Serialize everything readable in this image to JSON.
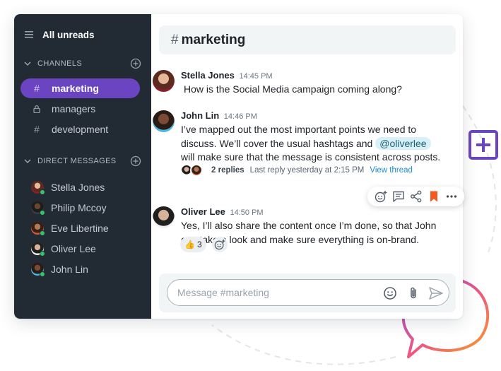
{
  "sidebar": {
    "title": "All unreads",
    "channels_header": "CHANNELS",
    "channels": [
      {
        "label": "marketing",
        "icon": "hash-icon",
        "active": true
      },
      {
        "label": "managers",
        "icon": "lock-icon",
        "active": false
      },
      {
        "label": "development",
        "icon": "hash-icon",
        "active": false
      }
    ],
    "dm_header": "DIRECT MESSAGES",
    "direct_messages": [
      {
        "label": "Stella Jones",
        "status": "online"
      },
      {
        "label": "Philip Mccoy",
        "status": "online"
      },
      {
        "label": "Eve Libertine",
        "status": "online"
      },
      {
        "label": "Oliver Lee",
        "status": "online"
      },
      {
        "label": "John Lin",
        "status": "online"
      }
    ]
  },
  "channel": {
    "hash": "#",
    "name": "marketing"
  },
  "messages": [
    {
      "author": "Stella Jones",
      "time": "14:45 PM",
      "text": "How is the Social Media campaign coming along?"
    },
    {
      "author": "John Lin",
      "time": "14:46 PM",
      "text_before": "I’ve mapped out the most important points we need to discuss. We’ll cover the usual hashtags and",
      "mention": "@oliverlee",
      "text_after": "will make sure that the message is consistent across posts.",
      "thread": {
        "replies": "2 replies",
        "last_reply": "Last reply yesterday at 2:15 PM",
        "view": "View thread"
      }
    },
    {
      "author": "Oliver Lee",
      "time": "14:50 PM",
      "text": "Yes, I’ll also share the content once I’m done, so that John can take a look and make sure everything is on-brand.",
      "reaction": {
        "emoji": "👍",
        "count": "3"
      }
    }
  ],
  "composer": {
    "placeholder": "Message #marketing"
  },
  "colors": {
    "sidebar_bg": "#222a33",
    "active_channel": "#6b44c2",
    "online": "#35c46a",
    "link": "#1a8fcf",
    "bookmark": "#f25a1f",
    "plus_badge": "#6b44c2"
  }
}
